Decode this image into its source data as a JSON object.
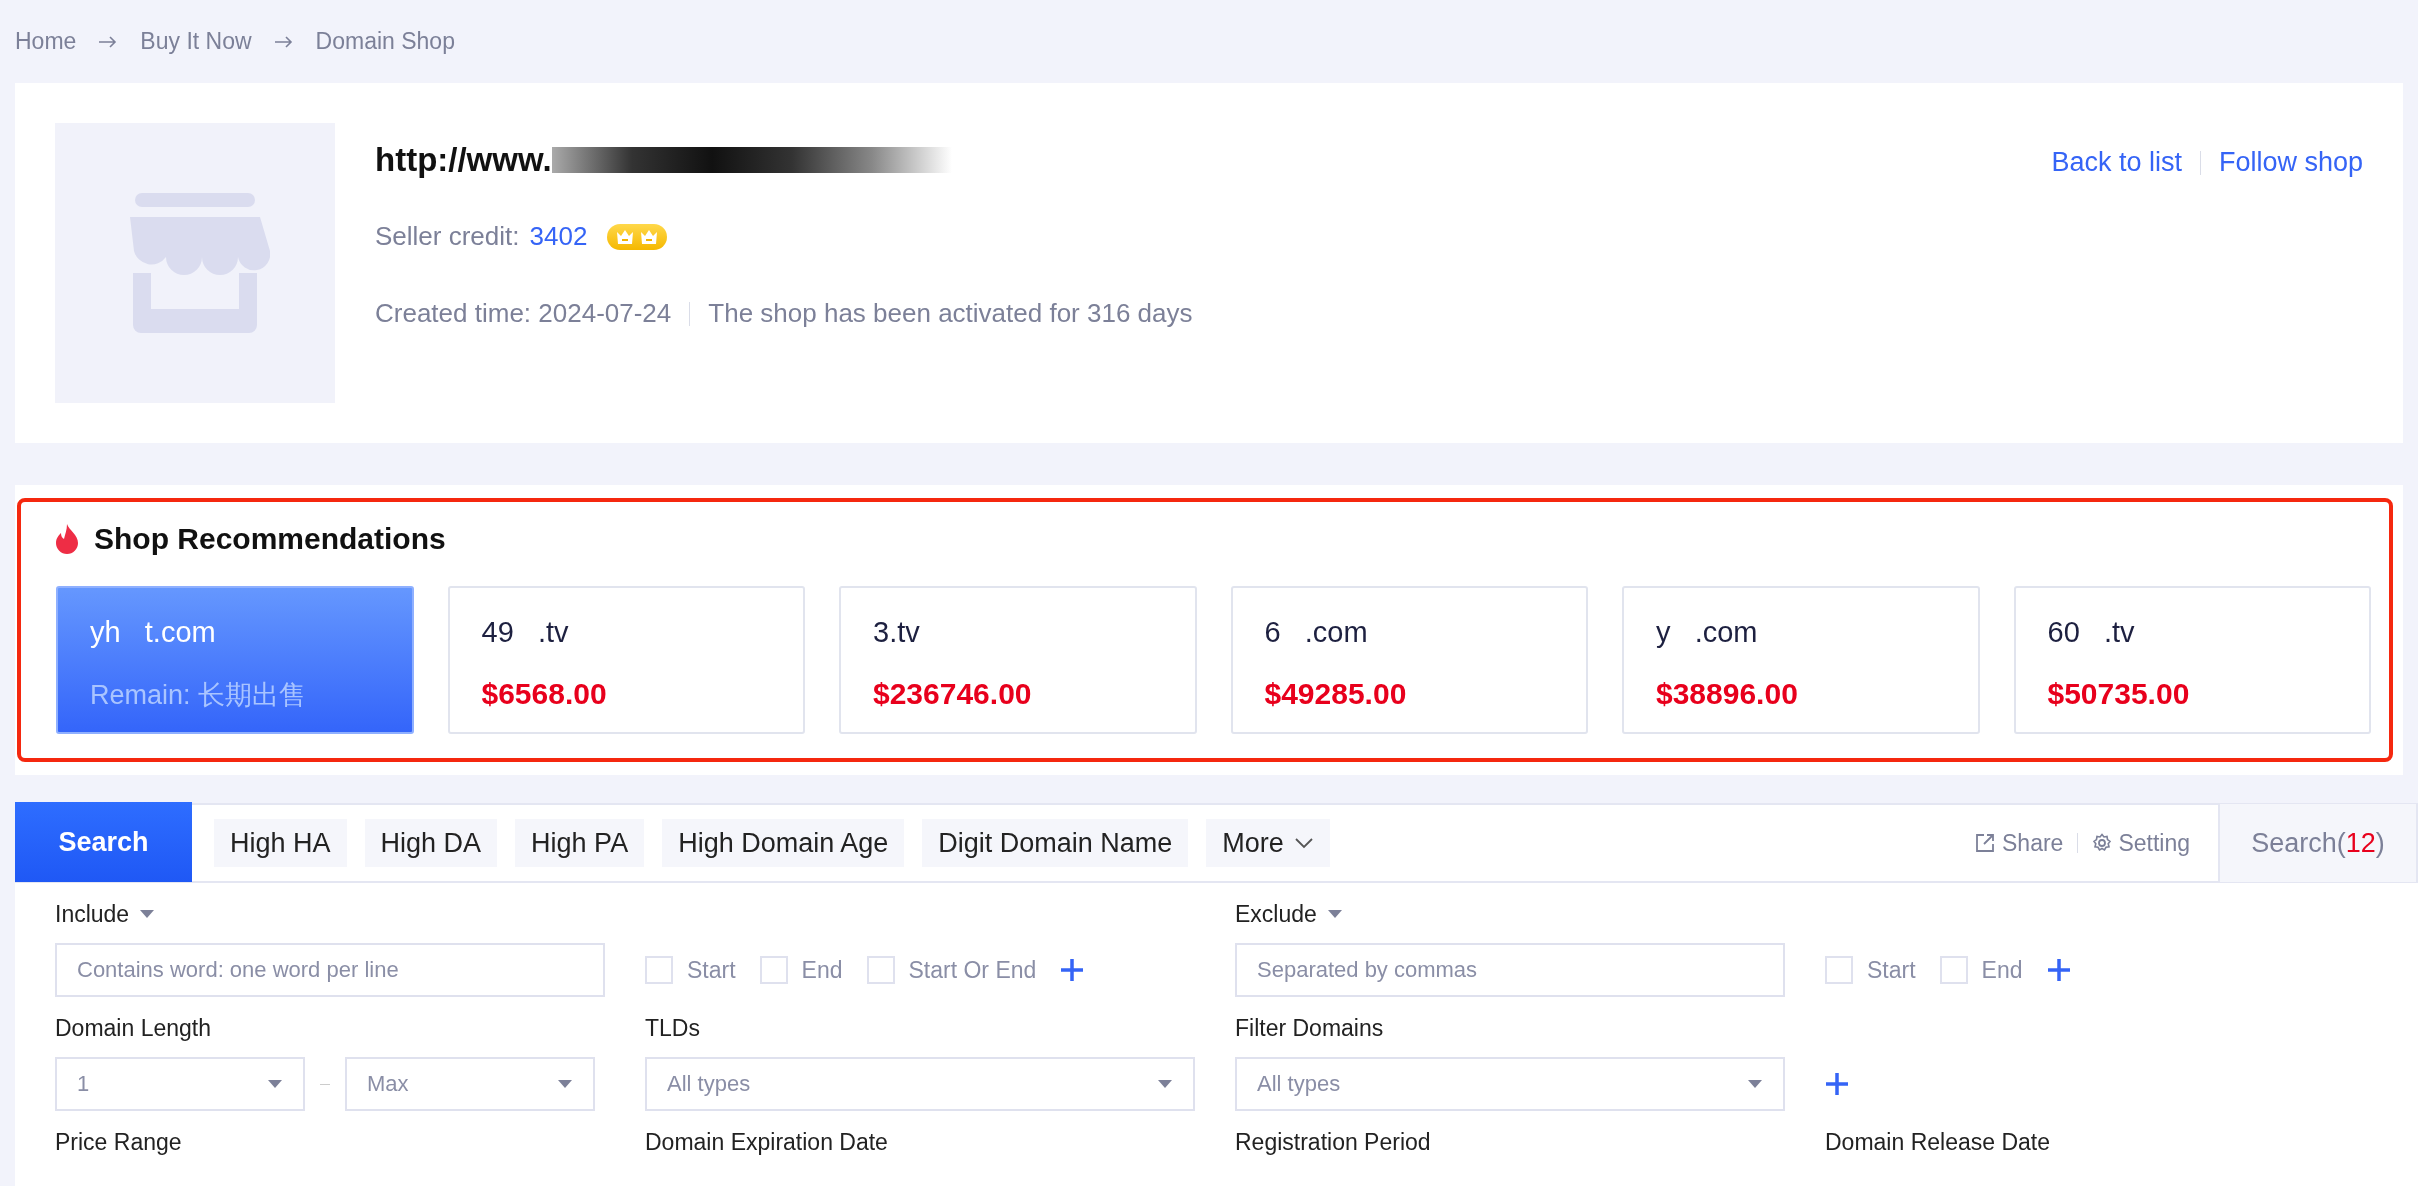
{
  "breadcrumb": [
    "Home",
    "Buy It Now",
    "Domain Shop"
  ],
  "shop": {
    "title": "http://www.",
    "credit_label": "Seller credit:",
    "credit": "3402",
    "created": "Created time: 2024-07-24",
    "activated": "The shop has been activated for 316 days",
    "links": [
      "Back to list",
      "Follow shop"
    ]
  },
  "recommendations": {
    "title": "Shop Recommendations",
    "cards": [
      {
        "domain": "yh   t.com",
        "remain": "Remain: 长期出售",
        "selected": true
      },
      {
        "domain": "49   .tv",
        "price": "$6568.00",
        "selected": false
      },
      {
        "domain": "3.tv",
        "price": "$236746.00",
        "selected": false
      },
      {
        "domain": "6   .com",
        "price": "$49285.00",
        "selected": false
      },
      {
        "domain": "y   .com",
        "price": "$38896.00",
        "selected": false
      },
      {
        "domain": "60   .tv",
        "price": "$50735.00",
        "selected": false
      }
    ]
  },
  "search_bar": {
    "tabs": [
      {
        "label": "Search",
        "selected": true
      }
    ],
    "chips": [
      {
        "label": "High HA",
        "kind": "plain"
      },
      {
        "label": "High DA",
        "kind": "plain"
      },
      {
        "label": "High PA",
        "kind": "plain"
      },
      {
        "label": "High Domain Age",
        "kind": "plain"
      },
      {
        "label": "Digit Domain Name",
        "kind": "plain"
      },
      {
        "label": "More",
        "kind": "dropdown"
      }
    ],
    "share": "Share",
    "setting": "Setting",
    "search_prefix": "Search(",
    "search_count": "12",
    "search_suffix": ")"
  },
  "filters": {
    "include": {
      "label": "Include",
      "placeholder": "Contains word: one word per line",
      "options": [
        {
          "label": "Start",
          "checked": false
        },
        {
          "label": "End",
          "checked": false
        },
        {
          "label": "Start Or End",
          "checked": false
        }
      ]
    },
    "exclude": {
      "label": "Exclude",
      "placeholder": "Separated by commas",
      "options": [
        {
          "label": "Start",
          "checked": false
        },
        {
          "label": "End",
          "checked": false
        }
      ]
    },
    "domain_length": {
      "label": "Domain Length",
      "min": "1",
      "max": "Max"
    },
    "tlds": {
      "label": "TLDs",
      "placeholder": "All types"
    },
    "filter_domains": {
      "label": "Filter Domains",
      "placeholder": "All types"
    },
    "more_labels": [
      "Price Range",
      "Domain Expiration Date",
      "Registration Period",
      "Domain Release Date"
    ]
  }
}
